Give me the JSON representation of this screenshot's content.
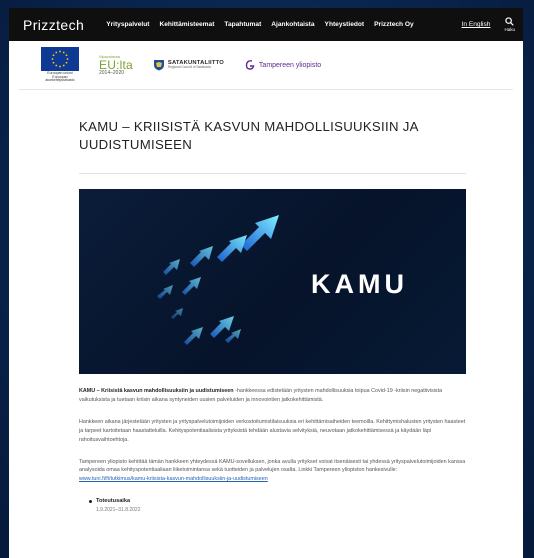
{
  "nav": {
    "brand": "Prizztech",
    "items": [
      "Yrityspalvelut",
      "Kehittämisteemat",
      "Tapahtumat",
      "Ajankohtaista",
      "Yhteystiedot",
      "Prizztech Oy"
    ],
    "language": "In English",
    "search_label": "Haku",
    "search_icon": "search-icon"
  },
  "logos": {
    "eu_caption_1": "Euroopan unioni",
    "eu_caption_2": "Euroopan aluekehitysrahasto",
    "euita_top": "Vipuvoimaa",
    "euita_main": "EU:lta",
    "euita_years": "2014–2020",
    "sata_name": "SATAKUNTALIITTO",
    "sata_sub": "Regional Council of Satakunta",
    "tuni_name": "Tampereen yliopisto"
  },
  "article": {
    "title": "KAMU – KRIISISTÄ KASVUN MAHDOLLISUUKSIIN JA UUDISTUMISEEN",
    "hero_logo": "KAMU",
    "intro_bold": "KAMU – Kriisistä kasvun mahdollisuuksiin ja uudistumiseen",
    "intro_rest": " -hankkeessa edistetään yritysten mahdollisuuksia toipua Covid-19 -kriisin negatiivisista vaikutuksista ja tuetaan kriisin aikana syntyneiden uusien palveluiden ja innovointien jatkokehittämistä.",
    "para2": "Hankkeen aikana järjestetään yritysten ja yrityspalvelutoimijoiden verkostoitumistilaisuuksia eri kehittämisaiheiden teemoilla. Kehittymishalusten yritysten haasteet ja tarpeet kartoitetaan haastatteluilla. Kehityspotentiaalisista yrityksistä tehdään alustavia selvityksiä, neuvotaan jatkokehittämisessä ja käydään läpi rahoitusvaihtoehtoja.",
    "para3": "Tampereen yliopisto kehittää tämän hankkeen yhteydessä KAMU-sovelluksen, jonka avulla yritykset voivat itsenäisesti tai yhdessä yrityspalvelutoimijoiden kanssa analysoida omaa kehityspotentiaaliaan liiketoimintansa sekä tuotteiden ja palvelujen osalta. Linkki Tampereen yliopiston hankesivulle:",
    "link": "www.tuni.fi/fi/tutkimus/kamu-kriisista-kasvun-mahdollisuuksiin-ja-uudistumiseen",
    "fact_label": "Toteutusaika",
    "fact_value": "1.9.2021–31.8.2022"
  },
  "colors": {
    "nav_bg": "#0f0f0f",
    "background": "#0a2752",
    "link": "#2463b4",
    "eu_blue": "#0f3a93",
    "euita_green": "#7aa12f",
    "tuni_purple": "#5b2b91"
  }
}
